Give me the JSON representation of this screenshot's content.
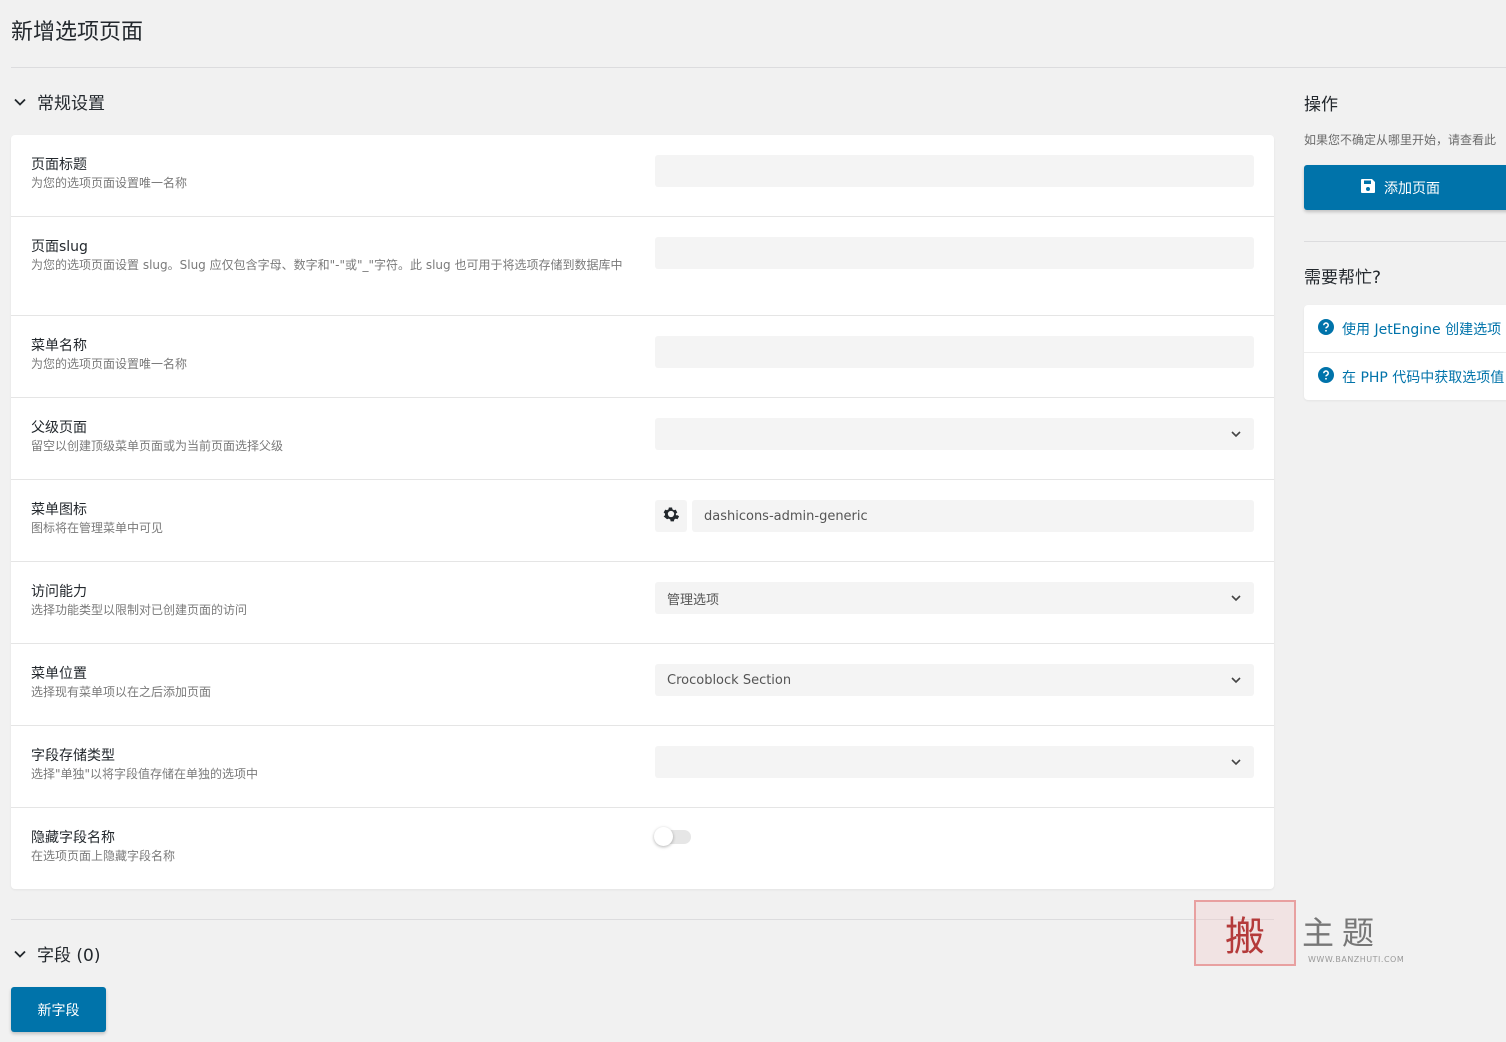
{
  "page_title": "新增选项页面",
  "general_section": {
    "title": "常规设置"
  },
  "settings": [
    {
      "label": "页面标题",
      "desc": "为您的选项页面设置唯一名称",
      "value": ""
    },
    {
      "label": "页面slug",
      "desc": "为您的选项页面设置 slug。Slug 应仅包含字母、数字和\"-\"或\"_\"字符。此 slug 也可用于将选项存储到数据库中",
      "value": ""
    },
    {
      "label": "菜单名称",
      "desc": "为您的选项页面设置唯一名称",
      "value": ""
    },
    {
      "label": "父级页面",
      "desc": "留空以创建顶级菜单页面或为当前页面选择父级",
      "value": ""
    },
    {
      "label": "菜单图标",
      "desc": "图标将在管理菜单中可见",
      "value": "dashicons-admin-generic"
    },
    {
      "label": "访问能力",
      "desc": "选择功能类型以限制对已创建页面的访问",
      "value": "管理选项"
    },
    {
      "label": "菜单位置",
      "desc": "选择现有菜单项以在之后添加页面",
      "value": "Crocoblock Section"
    },
    {
      "label": "字段存储类型",
      "desc": "选择\"单独\"以将字段值存储在单独的选项中",
      "value": ""
    },
    {
      "label": "隐藏字段名称",
      "desc": "在选项页面上隐藏字段名称",
      "value": false
    }
  ],
  "fields_section": {
    "title": "字段 (0)",
    "new_field_label": "新字段"
  },
  "sidebar": {
    "actions_title": "操作",
    "actions_hint": "如果您不确定从哪里开始，请查看此",
    "add_page_label": "添加页面",
    "help_title": "需要帮忙?",
    "help_links": [
      "使用 JetEngine 创建选项",
      "在 PHP 代码中获取选项值"
    ]
  },
  "watermark": {
    "seal": "搬",
    "text": "主题",
    "url": "WWW.BANZHUTI.COM"
  },
  "colors": {
    "primary": "#0073aa",
    "background": "#f1f1f1",
    "card": "#ffffff"
  }
}
